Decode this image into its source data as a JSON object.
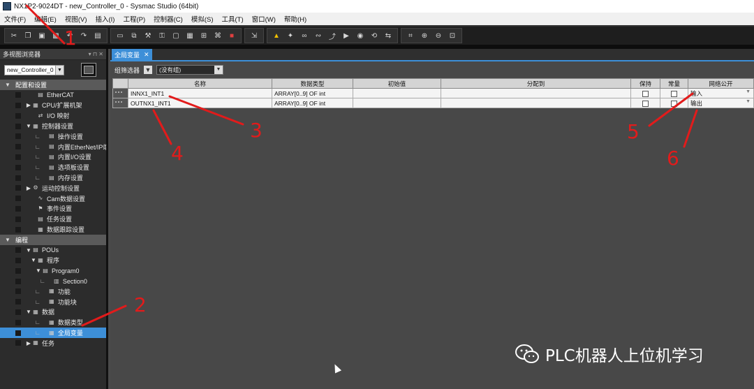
{
  "window": {
    "title": "NX1P2-9024DT - new_Controller_0 - Sysmac Studio (64bit)"
  },
  "menu": [
    "文件(F)",
    "编辑(E)",
    "视图(V)",
    "插入(I)",
    "工程(P)",
    "控制器(C)",
    "模拟(S)",
    "工具(T)",
    "窗口(W)",
    "帮助(H)"
  ],
  "toolbar": {
    "group1": [
      "cut-icon",
      "copy-icon",
      "paste-icon",
      "delete-icon",
      "undo-icon",
      "redo-icon",
      "print-icon"
    ],
    "group2": [
      "3d-icon",
      "build-icon",
      "wrench-icon",
      "cross-reference-icon",
      "window-icon",
      "layout-icon",
      "network-icon",
      "binoculars-icon",
      "stop-icon"
    ],
    "group3": [
      "cursor-tool-icon"
    ],
    "group4": [
      "warning-icon",
      "breakpoint-icon",
      "step-icon",
      "step-over-icon",
      "step-out-icon",
      "run-icon",
      "pause-icon",
      "reset-icon",
      "sync-icon"
    ],
    "group5": [
      "fit-icon",
      "zoom-in-icon",
      "zoom-out-icon",
      "zoom-reset-icon"
    ]
  },
  "left_pane": {
    "title": "多视图浏览器",
    "controller": "new_Controller_0",
    "tree": [
      {
        "label": "配置和设置",
        "type": "section",
        "arrow": "▼",
        "indent": 0,
        "icon": ""
      },
      {
        "label": "EtherCAT",
        "indent": 2,
        "arrow": "",
        "icon": "▤"
      },
      {
        "label": "CPU/扩展机架",
        "indent": 1,
        "arrow": "▶",
        "icon": "▦"
      },
      {
        "label": "I/O 映射",
        "indent": 2,
        "arrow": "",
        "icon": "⇄"
      },
      {
        "label": "控制器设置",
        "indent": 1,
        "arrow": "▼",
        "icon": "▦"
      },
      {
        "label": "操作设置",
        "indent": 3,
        "arrow": "",
        "icon": "▤",
        "lines": "∟"
      },
      {
        "label": "内置EtherNet/IP端口",
        "indent": 3,
        "arrow": "",
        "icon": "▤",
        "lines": "∟"
      },
      {
        "label": "内置I/O设置",
        "indent": 3,
        "arrow": "",
        "icon": "▤",
        "lines": "∟"
      },
      {
        "label": "选项板设置",
        "indent": 3,
        "arrow": "",
        "icon": "▤",
        "lines": "∟"
      },
      {
        "label": "内存设置",
        "indent": 3,
        "arrow": "",
        "icon": "▤",
        "lines": "∟"
      },
      {
        "label": "运动控制设置",
        "indent": 1,
        "arrow": "▶",
        "icon": "⚙"
      },
      {
        "label": "Cam数据设置",
        "indent": 2,
        "arrow": "",
        "icon": "∿"
      },
      {
        "label": "事件设置",
        "indent": 2,
        "arrow": "",
        "icon": "⚑"
      },
      {
        "label": "任务设置",
        "indent": 2,
        "arrow": "",
        "icon": "▤"
      },
      {
        "label": "数据跟踪设置",
        "indent": 2,
        "arrow": "",
        "icon": "▦"
      },
      {
        "label": "编程",
        "type": "section",
        "arrow": "▼",
        "indent": 0,
        "icon": ""
      },
      {
        "label": "POUs",
        "indent": 1,
        "arrow": "▼",
        "icon": "▤"
      },
      {
        "label": "程序",
        "indent": 2,
        "arrow": "▼",
        "icon": "▦"
      },
      {
        "label": "Program0",
        "indent": 3,
        "arrow": "▼",
        "icon": "▤"
      },
      {
        "label": "Section0",
        "indent": 4,
        "arrow": "",
        "icon": "▥",
        "lines": "∟"
      },
      {
        "label": "功能",
        "indent": 3,
        "arrow": "",
        "icon": "▦",
        "lines": "∟"
      },
      {
        "label": "功能块",
        "indent": 3,
        "arrow": "",
        "icon": "▦",
        "lines": "∟"
      },
      {
        "label": "数据",
        "indent": 1,
        "arrow": "▼",
        "icon": "▦"
      },
      {
        "label": "数据类型",
        "indent": 3,
        "arrow": "",
        "icon": "▦",
        "lines": "∟"
      },
      {
        "label": "全局变量",
        "indent": 3,
        "arrow": "",
        "icon": "▦",
        "lines": "∟",
        "selected": true
      },
      {
        "label": "任务",
        "indent": 1,
        "arrow": "▶",
        "icon": "▦"
      }
    ]
  },
  "editor": {
    "tab_label": "全局变量",
    "filter_label": "组筛选器",
    "group_value": "(没有组)",
    "columns": [
      "名称",
      "数据类型",
      "初始值",
      "分配到",
      "保持",
      "常量",
      "网络公开"
    ],
    "rows": [
      {
        "name": "INNX1_INT1",
        "type": "ARRAY[0..9] OF int",
        "initial": "",
        "assign": "",
        "retain": false,
        "constant": false,
        "network": "输入"
      },
      {
        "name": "OUTNX1_INT1",
        "type": "ARRAY[0..9] OF int",
        "initial": "",
        "assign": "",
        "retain": false,
        "constant": false,
        "network": "输出"
      }
    ]
  },
  "annotations": [
    "1",
    "2",
    "3",
    "4",
    "5",
    "6"
  ],
  "watermark": "PLC机器人上位机学习",
  "colors": {
    "accent": "#3d8fd8",
    "annotation": "#e21b1b"
  }
}
